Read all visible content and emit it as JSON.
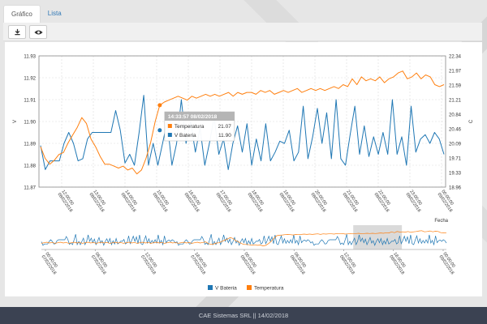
{
  "tabs": [
    {
      "label": "Gráfico",
      "active": true
    },
    {
      "label": "Lista",
      "active": false
    }
  ],
  "toolbar": {
    "download_icon": "download-icon",
    "view_icon": "eye-icon"
  },
  "chart_data": {
    "type": "line",
    "title": "",
    "xlabel": "Fecha",
    "y_left_label": "V",
    "y_right_label": "C",
    "y_left_ticks": [
      "11.93",
      "11.92",
      "11.91",
      "11.90",
      "11.89",
      "11.88",
      "11.87"
    ],
    "y_right_ticks": [
      "22.34",
      "21.97",
      "21.59",
      "21.21",
      "20.84",
      "20.46",
      "20.09",
      "19.71",
      "19.33",
      "18.96"
    ],
    "x_ticks": [
      [
        "12:00:00",
        "08/02/2018"
      ],
      [
        "13:00:00",
        "08/02/2018"
      ],
      [
        "14:00:00",
        "08/02/2018"
      ],
      [
        "15:00:00",
        "08/02/2018"
      ],
      [
        "16:00:00",
        "08/02/2018"
      ],
      [
        "17:00:00",
        "08/02/2018"
      ],
      [
        "18:00:00",
        "08/02/2018"
      ],
      [
        "19:00:00",
        "08/02/2018"
      ],
      [
        "20:00:00",
        "08/02/2018"
      ],
      [
        "21:00:00",
        "08/02/2018"
      ],
      [
        "22:00:00",
        "08/02/2018"
      ],
      [
        "23:00:00",
        "08/02/2018"
      ],
      [
        "00:00:00",
        "09/02/2018"
      ]
    ],
    "ylim_left": [
      11.87,
      11.93
    ],
    "ylim_right": [
      18.96,
      22.34
    ],
    "series": [
      {
        "name": "V Bateria",
        "color": "#1f77b4",
        "axis": "left",
        "values": [
          11.889,
          11.878,
          11.882,
          11.882,
          11.882,
          11.89,
          11.895,
          11.89,
          11.882,
          11.883,
          11.892,
          11.895,
          11.895,
          11.895,
          11.895,
          11.895,
          11.905,
          11.896,
          11.881,
          11.885,
          11.88,
          11.895,
          11.912,
          11.88,
          11.89,
          11.88,
          11.89,
          11.9,
          11.88,
          11.89,
          11.91,
          11.89,
          11.9,
          11.886,
          11.897,
          11.88,
          11.89,
          11.902,
          11.885,
          11.892,
          11.878,
          11.89,
          11.898,
          11.886,
          11.899,
          11.88,
          11.892,
          11.882,
          11.899,
          11.882,
          11.886,
          11.891,
          11.89,
          11.896,
          11.882,
          11.886,
          11.907,
          11.883,
          11.893,
          11.906,
          11.89,
          11.904,
          11.883,
          11.91,
          11.883,
          11.88,
          11.894,
          11.907,
          11.885,
          11.898,
          11.884,
          11.893,
          11.885,
          11.895,
          11.885,
          11.91,
          11.885,
          11.893,
          11.88,
          11.907,
          11.886,
          11.892,
          11.894,
          11.89,
          11.895,
          11.892,
          11.885
        ]
      },
      {
        "name": "Temperatura",
        "color": "#ff7f0e",
        "axis": "right",
        "values": [
          20.0,
          19.7,
          19.55,
          19.65,
          19.8,
          19.85,
          20.1,
          20.3,
          20.5,
          20.75,
          20.6,
          20.2,
          20.0,
          19.75,
          19.55,
          19.55,
          19.5,
          19.45,
          19.5,
          19.4,
          19.45,
          19.3,
          19.4,
          19.7,
          20.1,
          20.65,
          21.07,
          21.15,
          21.2,
          21.25,
          21.3,
          21.25,
          21.2,
          21.3,
          21.25,
          21.3,
          21.35,
          21.3,
          21.35,
          21.3,
          21.35,
          21.4,
          21.3,
          21.4,
          21.35,
          21.4,
          21.4,
          21.35,
          21.45,
          21.4,
          21.45,
          21.35,
          21.4,
          21.45,
          21.4,
          21.45,
          21.5,
          21.4,
          21.45,
          21.5,
          21.45,
          21.5,
          21.45,
          21.5,
          21.55,
          21.5,
          21.6,
          21.55,
          21.75,
          21.6,
          21.8,
          21.7,
          21.75,
          21.7,
          21.8,
          21.65,
          21.75,
          21.8,
          21.9,
          21.95,
          21.75,
          21.8,
          21.9,
          21.75,
          21.85,
          21.8,
          21.6,
          21.55,
          21.6
        ]
      }
    ],
    "tooltip": {
      "time": "14:33:57 08/02/2018",
      "rows": [
        {
          "name": "Temperatura",
          "value": "21.07",
          "color": "#ff7f0e"
        },
        {
          "name": "V Bateria",
          "value": "11.90",
          "color": "#1f77b4"
        }
      ]
    },
    "navigator": {
      "x_ticks": [
        [
          "00:00:00",
          "07/02/2018"
        ],
        [
          "06:00:00",
          "07/02/2018"
        ],
        [
          "12:00:00",
          "07/02/2018"
        ],
        [
          "18:00:00",
          "07/02/2018"
        ],
        [
          "00:00:00",
          "08/02/2018"
        ],
        [
          "06:00:00",
          "08/02/2018"
        ],
        [
          "12:00:00",
          "08/02/2018"
        ],
        [
          "18:00:00",
          "08/02/2018"
        ],
        [
          "00:00:00",
          "09/02/2018"
        ]
      ],
      "selection_fraction": [
        0.77,
        0.89
      ]
    },
    "legend": [
      {
        "name": "V Bateria",
        "color": "#1f77b4"
      },
      {
        "name": "Temperatura",
        "color": "#ff7f0e"
      }
    ],
    "legend_position": "bottom-center"
  },
  "footer": {
    "text": "CAE Sistemas SRL || 14/02/2018"
  }
}
